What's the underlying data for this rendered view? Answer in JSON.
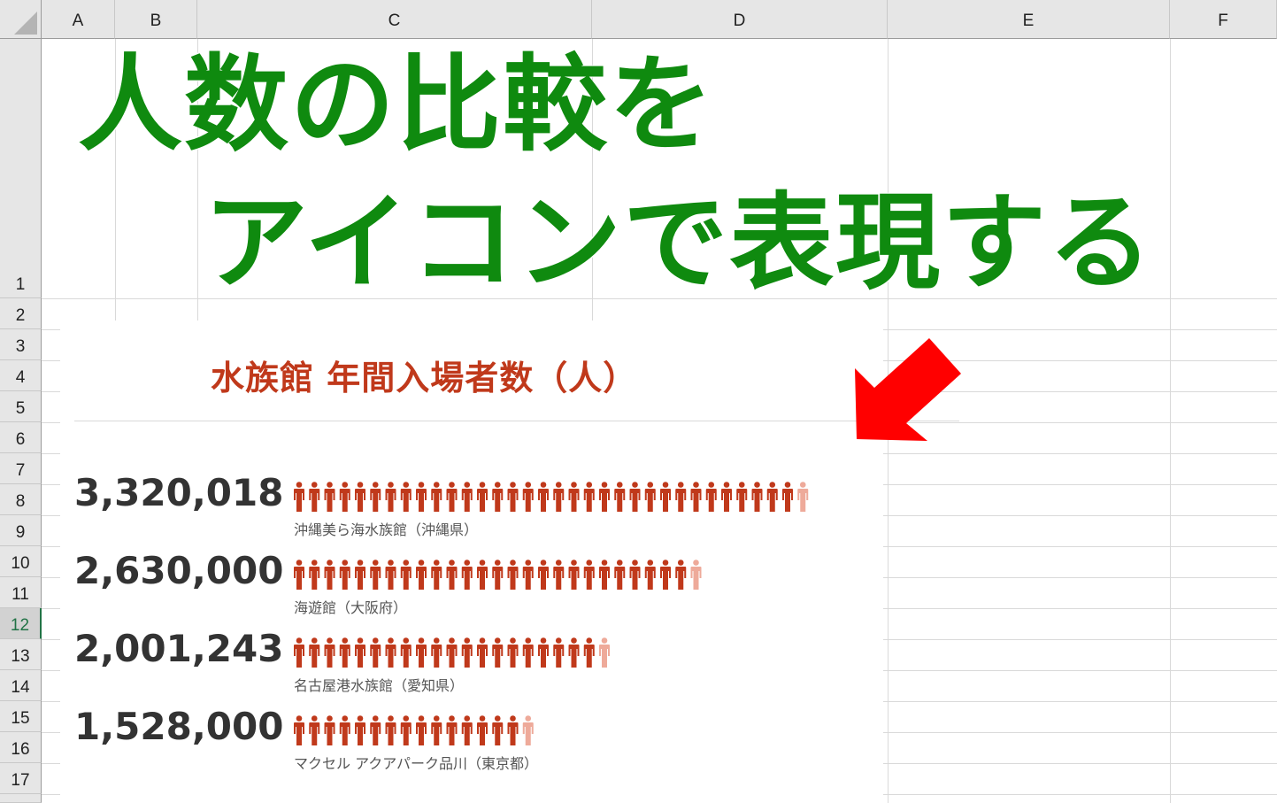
{
  "spreadsheet": {
    "columns": [
      "A",
      "B",
      "C",
      "D",
      "E",
      "F"
    ],
    "rows": [
      "1",
      "2",
      "3",
      "4",
      "5",
      "6",
      "7",
      "8",
      "9",
      "10",
      "11",
      "12",
      "13",
      "14",
      "15",
      "16",
      "17"
    ],
    "selected_row": "12"
  },
  "sheet_title": {
    "line1": "人数の比較を",
    "line2": "アイコンで表現する",
    "color": "#0f8a0f"
  },
  "chart_data": {
    "type": "pictograph",
    "title": "水族館 年間入場者数（人）",
    "unit_icon": "person-icon",
    "color_full": "#c0391b",
    "color_partial": "#eeaa9a",
    "series": [
      {
        "category": "沖縄美ら海水族館（沖縄県）",
        "value": 3320018,
        "display": "3,320,018"
      },
      {
        "category": "海遊館（大阪府）",
        "value": 2630000,
        "display": "2,630,000"
      },
      {
        "category": "名古屋港水族館（愛知県）",
        "value": 2001243,
        "display": "2,001,243"
      },
      {
        "category": "マクセル アクアパーク品川（東京都）",
        "value": 1528000,
        "display": "1,528,000"
      }
    ]
  },
  "annotation": {
    "icon": "red-arrow-icon",
    "color": "#ff0000"
  }
}
